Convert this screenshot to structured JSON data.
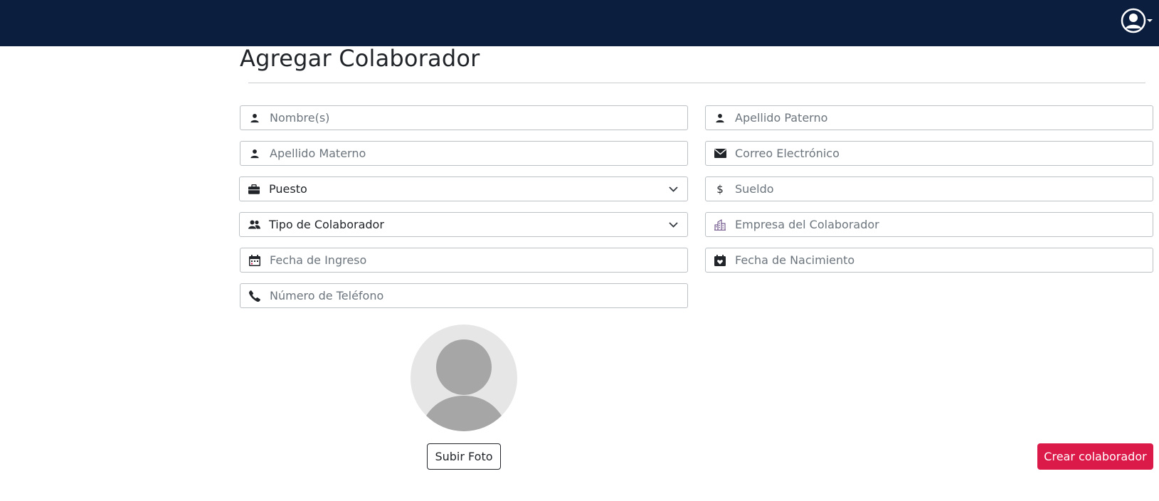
{
  "navbar": {
    "background": "#0c1e3e",
    "user_icon": "user-circle-icon",
    "dropdown_icon": "caret-down-icon"
  },
  "page": {
    "title": "Agregar Colaborador"
  },
  "form": {
    "nombre": {
      "placeholder": "Nombre(s)",
      "value": "",
      "icon": "person-icon"
    },
    "apellido_paterno": {
      "placeholder": "Apellido Paterno",
      "value": "",
      "icon": "person-icon"
    },
    "apellido_materno": {
      "placeholder": "Apellido Materno",
      "value": "",
      "icon": "person-icon"
    },
    "correo": {
      "placeholder": "Correo Electrónico",
      "value": "",
      "icon": "envelope-icon"
    },
    "puesto": {
      "selected": "Puesto",
      "icon": "briefcase-icon"
    },
    "sueldo": {
      "placeholder": "Sueldo",
      "value": "",
      "icon": "dollar-icon"
    },
    "tipo_colaborador": {
      "selected": "Tipo de Colaborador",
      "icon": "people-icon"
    },
    "empresa": {
      "placeholder": "Empresa del Colaborador",
      "value": "",
      "icon": "building-icon"
    },
    "fecha_ingreso": {
      "placeholder": "Fecha de Ingreso",
      "value": "",
      "icon": "calendar-icon"
    },
    "fecha_nacimiento": {
      "placeholder": "Fecha de Nacimiento",
      "value": "",
      "icon": "calendar-heart-icon"
    },
    "telefono": {
      "placeholder": "Número de Teléfono",
      "value": "",
      "icon": "phone-icon"
    }
  },
  "photo": {
    "upload_label": "Subir Foto",
    "placeholder_icon": "avatar-placeholder-icon"
  },
  "actions": {
    "create_label": "Crear colaborador",
    "create_color": "#dc1a4a"
  }
}
